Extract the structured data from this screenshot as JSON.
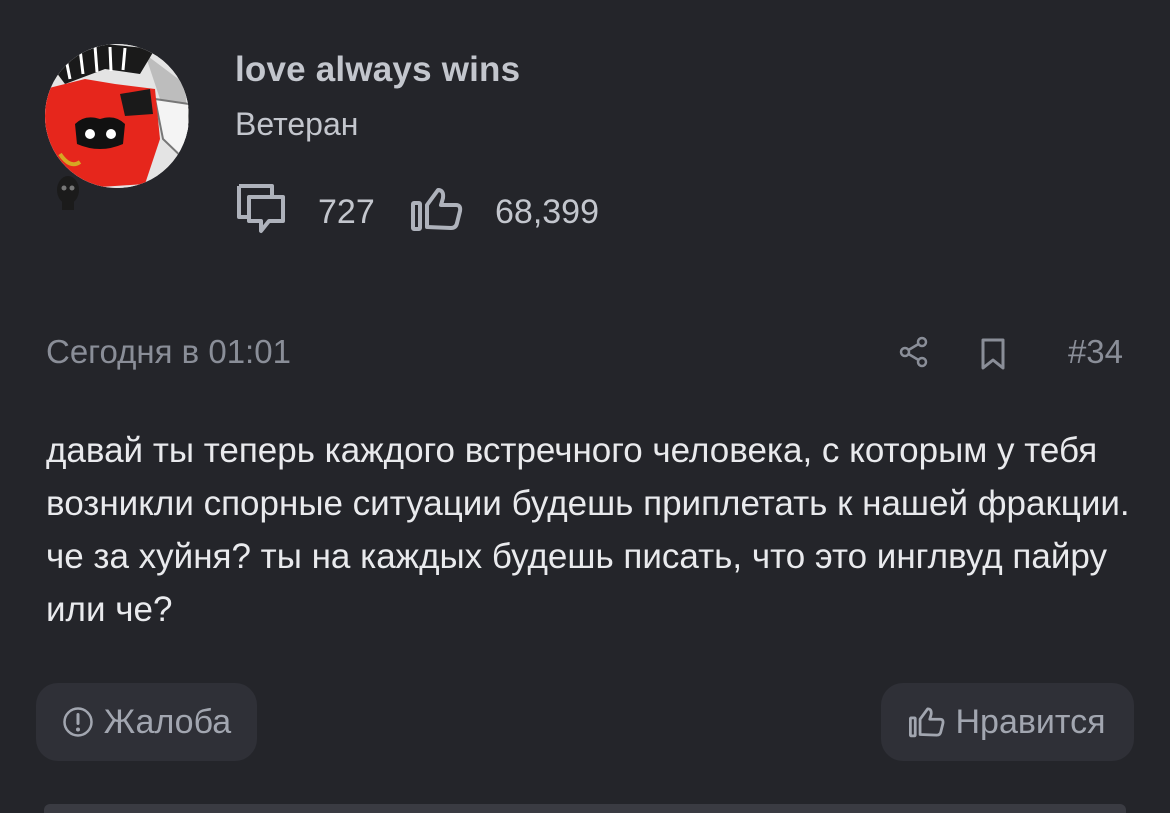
{
  "user": {
    "name": "love always wins",
    "rank": "Ветеран",
    "messages_count": "727",
    "likes_count": "68,399"
  },
  "post": {
    "timestamp": "Сегодня в 01:01",
    "number": "#34",
    "text": "давай ты теперь каждого встречного человека, с которым у тебя возникли спорные ситуации будешь приплетать к нашей фракции. че за хуйня? ты на каждых будешь писать, что это инглвуд пайру или че?"
  },
  "actions": {
    "report_label": "Жалоба",
    "like_label": "Нравится"
  },
  "icons": {
    "messages": "speech-bubbles-icon",
    "likes": "thumbs-up-icon",
    "share": "share-icon",
    "bookmark": "bookmark-icon",
    "report": "exclamation-circle-icon"
  },
  "colors": {
    "background": "#24252a",
    "button_bg": "#2f3037",
    "muted_text": "#8a8e98",
    "avatar_red": "#e6261c"
  }
}
